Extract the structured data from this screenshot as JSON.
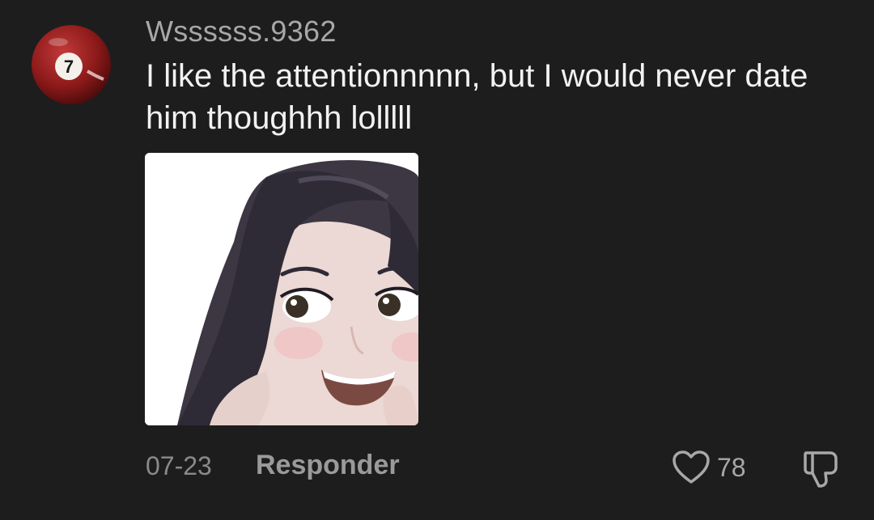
{
  "comment": {
    "username": "Wssssss.9362",
    "text": "I like the attentionnnnn, but I would never date him thoughhh lolllll",
    "avatar": {
      "icon": "billiard-ball-7-icon",
      "label": "7",
      "color": "#8e1a1a"
    },
    "sticker": {
      "icon": "girl-memoji-sticker"
    },
    "date": "07-23",
    "reply_label": "Responder",
    "likes": "78",
    "like_icon": "heart-outline-icon",
    "dislike_icon": "thumbs-down-icon"
  },
  "colors": {
    "background": "#1d1d1d",
    "username": "#a8a8a8",
    "text": "#f2f2f2",
    "meta": "#8a8a8a"
  }
}
